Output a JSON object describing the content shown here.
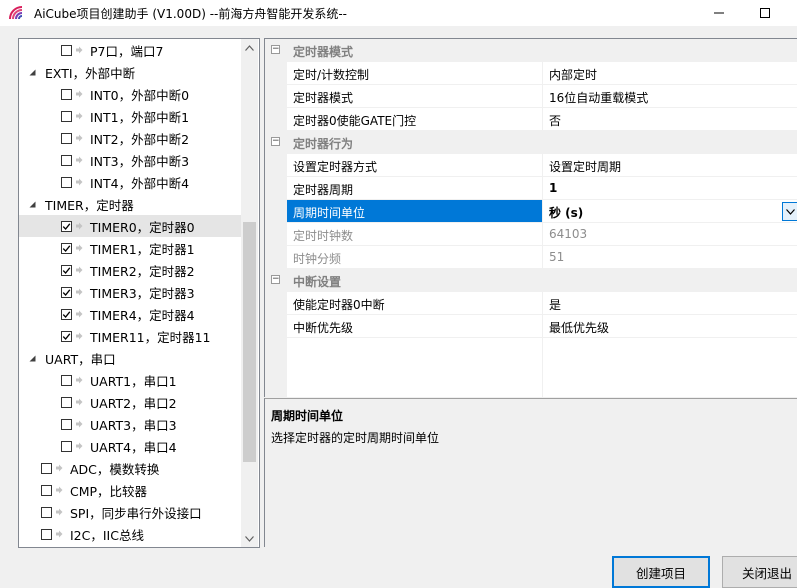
{
  "window": {
    "title": "AiCube项目创建助手 (V1.00D) --前海方舟智能开发系统--"
  },
  "tree": {
    "items": [
      {
        "label": "P7口，端口7",
        "level": 2,
        "checked": false,
        "expander": "",
        "selected": false
      },
      {
        "label": "EXTI，外部中断",
        "level": 1,
        "checked": null,
        "expander": "collapse",
        "selected": false
      },
      {
        "label": "INT0，外部中断0",
        "level": 2,
        "checked": false,
        "expander": "",
        "selected": false
      },
      {
        "label": "INT1，外部中断1",
        "level": 2,
        "checked": false,
        "expander": "",
        "selected": false
      },
      {
        "label": "INT2，外部中断2",
        "level": 2,
        "checked": false,
        "expander": "",
        "selected": false
      },
      {
        "label": "INT3，外部中断3",
        "level": 2,
        "checked": false,
        "expander": "",
        "selected": false
      },
      {
        "label": "INT4，外部中断4",
        "level": 2,
        "checked": false,
        "expander": "",
        "selected": false
      },
      {
        "label": "TIMER，定时器",
        "level": 1,
        "checked": null,
        "expander": "collapse",
        "selected": false
      },
      {
        "label": "TIMER0，定时器0",
        "level": 2,
        "checked": true,
        "expander": "",
        "selected": true
      },
      {
        "label": "TIMER1，定时器1",
        "level": 2,
        "checked": true,
        "expander": "",
        "selected": false
      },
      {
        "label": "TIMER2，定时器2",
        "level": 2,
        "checked": true,
        "expander": "",
        "selected": false
      },
      {
        "label": "TIMER3，定时器3",
        "level": 2,
        "checked": true,
        "expander": "",
        "selected": false
      },
      {
        "label": "TIMER4，定时器4",
        "level": 2,
        "checked": true,
        "expander": "",
        "selected": false
      },
      {
        "label": "TIMER11，定时器11",
        "level": 2,
        "checked": true,
        "expander": "",
        "selected": false
      },
      {
        "label": "UART，串口",
        "level": 1,
        "checked": null,
        "expander": "collapse",
        "selected": false
      },
      {
        "label": "UART1，串口1",
        "level": 2,
        "checked": false,
        "expander": "",
        "selected": false
      },
      {
        "label": "UART2，串口2",
        "level": 2,
        "checked": false,
        "expander": "",
        "selected": false
      },
      {
        "label": "UART3，串口3",
        "level": 2,
        "checked": false,
        "expander": "",
        "selected": false
      },
      {
        "label": "UART4，串口4",
        "level": 2,
        "checked": false,
        "expander": "",
        "selected": false
      },
      {
        "label": "ADC，模数转换",
        "level": 1,
        "checked": false,
        "expander": "",
        "selected": false
      },
      {
        "label": "CMP，比较器",
        "level": 1,
        "checked": false,
        "expander": "",
        "selected": false
      },
      {
        "label": "SPI，同步串行外设接口",
        "level": 1,
        "checked": false,
        "expander": "",
        "selected": false
      },
      {
        "label": "I2C，IIC总线",
        "level": 1,
        "checked": false,
        "expander": "",
        "selected": false
      }
    ]
  },
  "properties": {
    "categories": [
      {
        "label": "定时器模式",
        "rows": [
          {
            "name": "定时/计数控制",
            "value": "内部定时",
            "state": "normal"
          },
          {
            "name": "定时器模式",
            "value": "16位自动重载模式",
            "state": "normal"
          },
          {
            "name": "定时器0使能GATE门控",
            "value": "否",
            "state": "normal"
          }
        ]
      },
      {
        "label": "定时器行为",
        "rows": [
          {
            "name": "设置定时器方式",
            "value": "设置定时周期",
            "state": "normal"
          },
          {
            "name": "定时器周期",
            "value": "1",
            "state": "bold"
          },
          {
            "name": "周期时间单位",
            "value": "秒 (s)",
            "state": "selected"
          },
          {
            "name": "定时时钟数",
            "value": "64103",
            "state": "disabled"
          },
          {
            "name": "时钟分频",
            "value": "51",
            "state": "disabled"
          }
        ]
      },
      {
        "label": "中断设置",
        "rows": [
          {
            "name": "使能定时器0中断",
            "value": "是",
            "state": "normal"
          },
          {
            "name": "中断优先级",
            "value": "最低优先级",
            "state": "normal"
          }
        ]
      }
    ]
  },
  "description": {
    "title": "周期时间单位",
    "body": "选择定时器的定时周期时间单位"
  },
  "buttons": {
    "create": "创建项目",
    "close": "关闭退出"
  },
  "colors": {
    "selection": "#0078d7",
    "category_text": "#808080",
    "disabled_text": "#8d8d8d"
  }
}
